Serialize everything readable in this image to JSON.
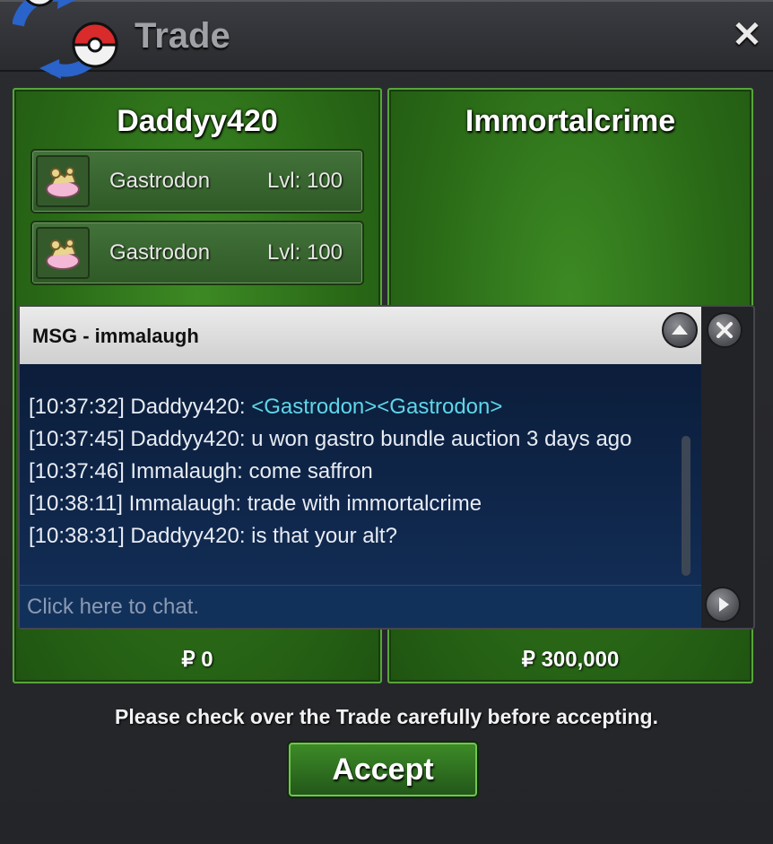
{
  "window": {
    "title": "Trade",
    "close_icon": "close-icon"
  },
  "left_panel": {
    "player_name": "Daddyy420",
    "pokemon": [
      {
        "name": "Gastrodon",
        "level": "Lvl: 100",
        "icon": "gastrodon-sprite-icon"
      },
      {
        "name": "Gastrodon",
        "level": "Lvl: 100",
        "icon": "gastrodon-sprite-icon"
      }
    ],
    "money": "₽ 0"
  },
  "right_panel": {
    "player_name": "Immortalcrime",
    "money": "₽ 300,000"
  },
  "chat": {
    "title": "MSG - immalaugh",
    "lines": [
      {
        "text_before": "[10:37:32] Daddyy420: ",
        "link": "<Gastrodon><Gastrodon>"
      },
      {
        "text_before": "[10:37:45] Daddyy420: u won gastro bundle auction 3 days ago",
        "link": ""
      },
      {
        "text_before": "[10:37:46] Immalaugh: come saffron",
        "link": ""
      },
      {
        "text_before": "[10:38:11] Immalaugh: trade with immortalcrime",
        "link": ""
      },
      {
        "text_before": "[10:38:31] Daddyy420: is that your alt?",
        "link": ""
      }
    ],
    "input_placeholder": "Click here to chat.",
    "link_color": "#5fd6e9"
  },
  "footer": {
    "notice": "Please check over the Trade carefully before accepting.",
    "accept_label": "Accept"
  }
}
